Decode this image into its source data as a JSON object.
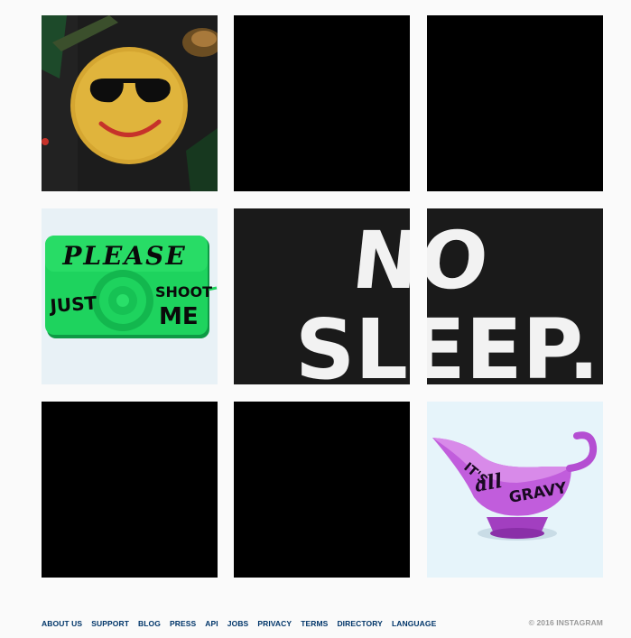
{
  "grid": {
    "posts": [
      {
        "alt_icon": "smiley-cake-photo"
      },
      {
        "alt_icon": "blank-black-photo"
      },
      {
        "alt_icon": "blank-black-photo"
      },
      {
        "alt_icon": "green-camera-photo"
      },
      {
        "alt_icon": "no-sleep-lettering-photo"
      },
      {
        "alt_icon": "blank-black-photo"
      },
      {
        "alt_icon": "blank-black-photo"
      },
      {
        "alt_icon": "purple-gravy-boat-photo"
      }
    ],
    "camera_text": {
      "line1": "PLEASE",
      "left": "JUST",
      "right1": "SHOOT",
      "right2": "ME"
    },
    "nosleep_text": {
      "top": "NO",
      "bottom": "SLEEP."
    },
    "gravy_text": {
      "a": "IT'S",
      "b": "all",
      "c": "GRAVY"
    }
  },
  "footer": {
    "links": [
      "ABOUT US",
      "SUPPORT",
      "BLOG",
      "PRESS",
      "API",
      "JOBS",
      "PRIVACY",
      "TERMS",
      "DIRECTORY",
      "LANGUAGE"
    ],
    "copyright": "© 2016 INSTAGRAM"
  },
  "colors": {
    "link": "#003569",
    "copyright": "#999999",
    "background": "#fafafa"
  }
}
